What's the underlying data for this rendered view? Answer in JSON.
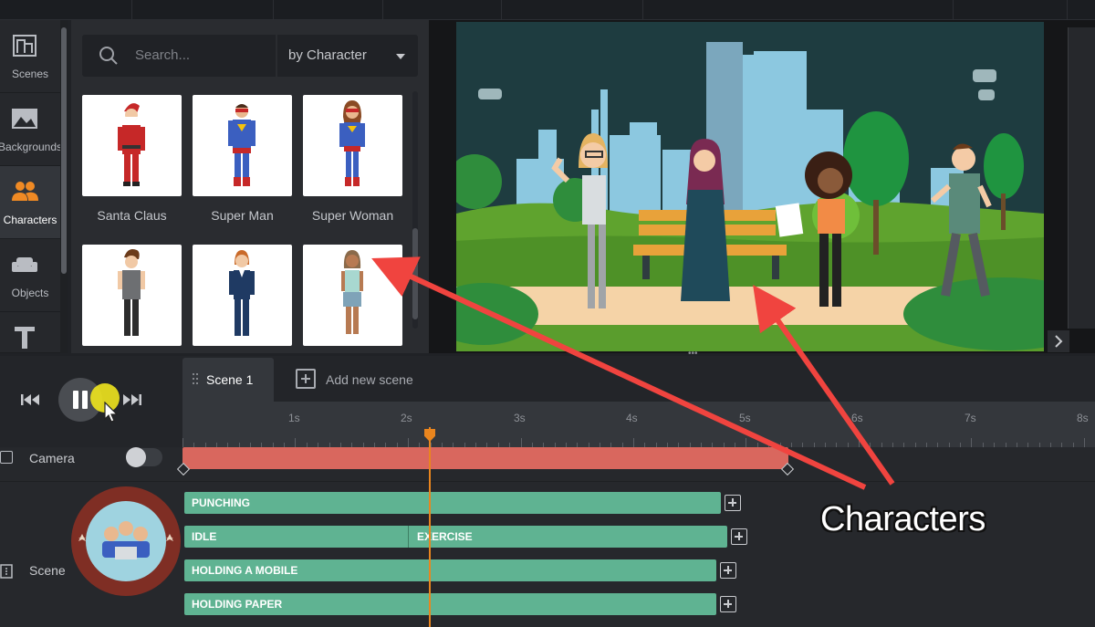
{
  "sidebar": {
    "items": [
      {
        "label": "Scenes",
        "icon": "scenes-icon"
      },
      {
        "label": "Backgrounds",
        "icon": "backgrounds-icon"
      },
      {
        "label": "Characters",
        "icon": "characters-icon",
        "active": true
      },
      {
        "label": "Objects",
        "icon": "objects-icon"
      },
      {
        "label": "",
        "icon": "text-icon"
      }
    ]
  },
  "library": {
    "search_placeholder": "Search...",
    "filter_value": "by Character",
    "cards": [
      {
        "name": "Santa Claus"
      },
      {
        "name": "Super Man"
      },
      {
        "name": "Super Woman"
      },
      {
        "name": ""
      },
      {
        "name": ""
      },
      {
        "name": ""
      }
    ]
  },
  "timeline": {
    "scene_tab": "Scene 1",
    "add_scene": "Add new scene",
    "ticks": [
      "1s",
      "2s",
      "3s",
      "4s",
      "5s",
      "6s",
      "7s",
      "8s"
    ],
    "rows": {
      "camera": "Camera",
      "scene": "Scene"
    },
    "tracks": [
      {
        "label": "PUNCHING"
      },
      {
        "label": "IDLE",
        "second_label": "EXERCISE"
      },
      {
        "label": "HOLDING A MOBILE"
      },
      {
        "label": "HOLDING PAPER"
      }
    ]
  },
  "annotation": {
    "callout": "Characters"
  },
  "colors": {
    "camera_bar": "#d9675e",
    "track_bar": "#5fb392",
    "playhead": "#e9851e",
    "annotation_arrow": "#f0443f"
  }
}
